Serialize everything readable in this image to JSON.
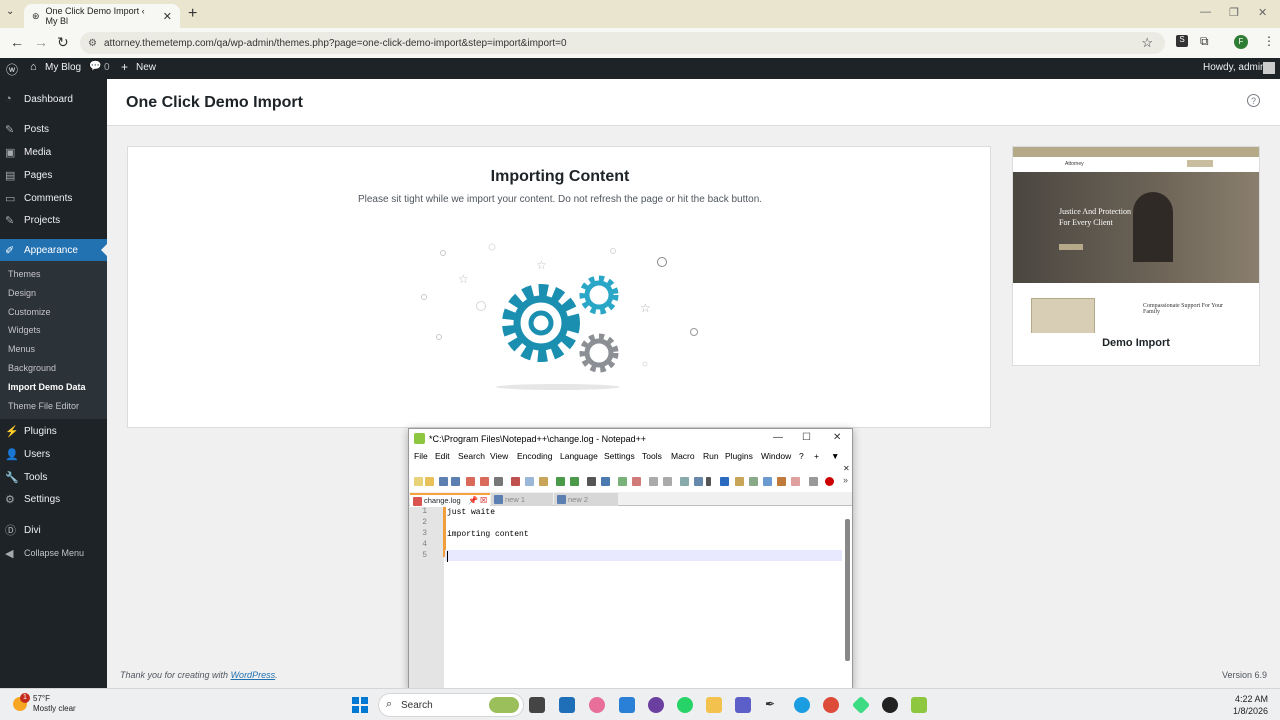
{
  "browser": {
    "tab_title": "One Click Demo Import ‹ My Bl",
    "url": "attorney.themetemp.com/qa/wp-admin/themes.php?page=one-click-demo-import&step=import&import=0",
    "profile_initial": "F"
  },
  "adminbar": {
    "site_name": "My Blog",
    "comments_count": "0",
    "new_label": "New",
    "greeting": "Howdy, admin"
  },
  "sidebar": {
    "items": [
      {
        "label": "Dashboard"
      },
      {
        "label": "Posts"
      },
      {
        "label": "Media"
      },
      {
        "label": "Pages"
      },
      {
        "label": "Comments"
      },
      {
        "label": "Projects"
      },
      {
        "label": "Appearance"
      },
      {
        "label": "Plugins"
      },
      {
        "label": "Users"
      },
      {
        "label": "Tools"
      },
      {
        "label": "Settings"
      },
      {
        "label": "Divi"
      },
      {
        "label": "Collapse Menu"
      }
    ],
    "submenu": [
      "Themes",
      "Design",
      "Customize",
      "Widgets",
      "Menus",
      "Background",
      "Import Demo Data",
      "Theme File Editor"
    ]
  },
  "page": {
    "title": "One Click Demo Import",
    "heading": "Importing Content",
    "description": "Please sit tight while we import your content. Do not refresh the page or hit the back button.",
    "preview_label": "Demo Import",
    "preview_logo": "Attorney",
    "preview_hero_text": "Justice And Protection For Every Client",
    "preview_sub_text": "Compassionate Support For Your Family",
    "footer_prefix": "Thank you for creating with ",
    "footer_link": "WordPress",
    "footer_suffix": ".",
    "version": "Version 6.9"
  },
  "notepad": {
    "title": "*C:\\Program Files\\Notepad++\\change.log - Notepad++",
    "menu": [
      "File",
      "Edit",
      "Search",
      "View",
      "Encoding",
      "Language",
      "Settings",
      "Tools",
      "Macro",
      "Run",
      "Plugins",
      "Window",
      "?",
      "+",
      "▼"
    ],
    "tabs": [
      "change.log",
      "new 1",
      "new 2"
    ],
    "line_numbers": [
      "1",
      "2",
      "3",
      "4",
      "5"
    ],
    "lines": [
      "just waite",
      "",
      "importing content",
      "",
      ""
    ]
  },
  "taskbar": {
    "temperature": "57°F",
    "weather": "Mostly clear",
    "weather_badge": "1",
    "search_placeholder": "Search",
    "time": "4:22 AM",
    "date": "1/8/2026"
  },
  "colors": {
    "wp_dark": "#1d2327",
    "wp_blue": "#2271b1",
    "gear_blue": "#1b8fb0",
    "gear_teal": "#2aa6c6",
    "gear_gray": "#8c8f94"
  }
}
